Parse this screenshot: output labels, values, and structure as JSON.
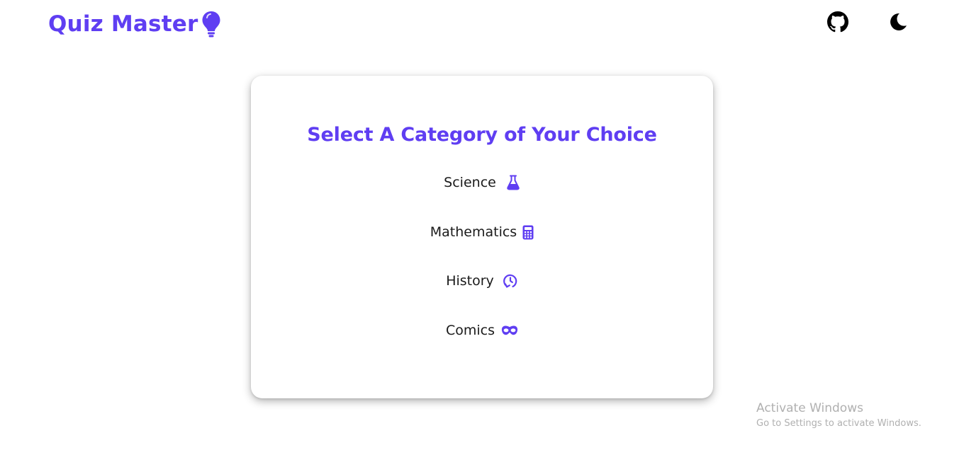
{
  "header": {
    "title": "Quiz Master",
    "logo_icon": "lightbulb-icon",
    "github_icon": "github-icon",
    "theme_icon": "moon-icon"
  },
  "card": {
    "title": "Select A Category of Your Choice",
    "categories": [
      {
        "label": "Science",
        "icon": "flask-icon"
      },
      {
        "label": "Mathematics",
        "icon": "calculator-icon"
      },
      {
        "label": "History",
        "icon": "history-icon"
      },
      {
        "label": "Comics",
        "icon": "mask-icon"
      }
    ]
  },
  "watermark": {
    "title": "Activate Windows",
    "subtitle": "Go to Settings to activate Windows."
  },
  "colors": {
    "accent": "#5f3ef2",
    "text": "#1a1a1a",
    "watermark": "#b0b0b0"
  }
}
